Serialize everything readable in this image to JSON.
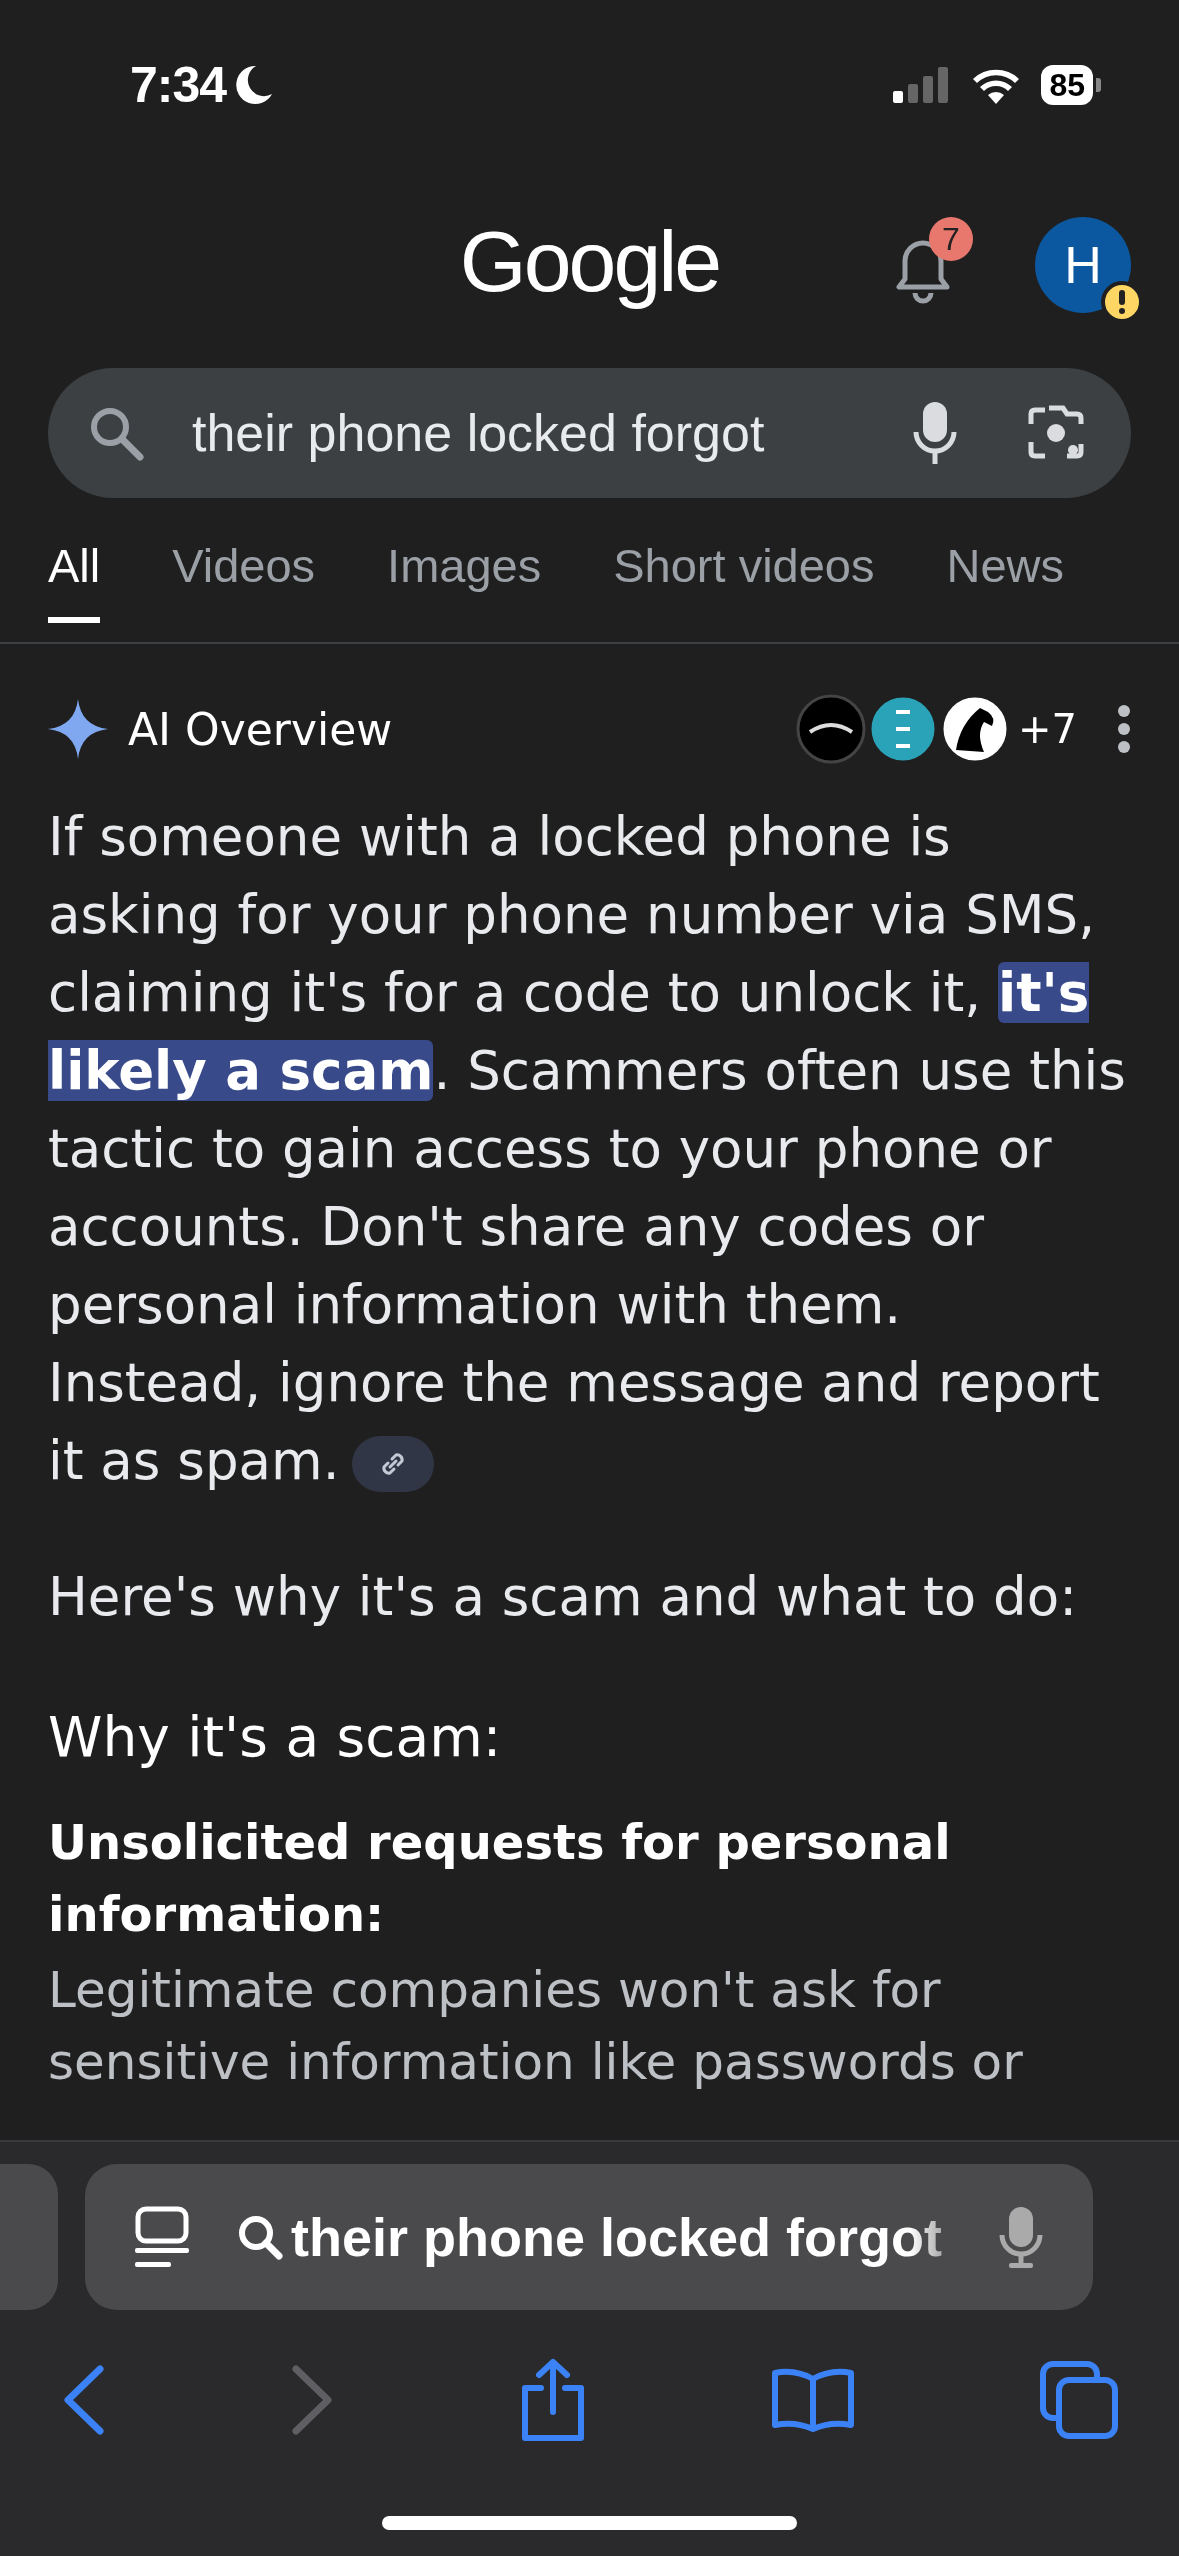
{
  "status_bar": {
    "time": "7:34",
    "battery": "85"
  },
  "header": {
    "logo": "Google",
    "notification_count": "7",
    "avatar": {
      "initial": "H",
      "warning": true
    }
  },
  "search": {
    "value": "their phone locked forgot"
  },
  "tabs": [
    {
      "label": "All",
      "selected": true
    },
    {
      "label": "Videos",
      "selected": false
    },
    {
      "label": "Images",
      "selected": false
    },
    {
      "label": "Short videos",
      "selected": false
    },
    {
      "label": "News",
      "selected": false
    }
  ],
  "ai_overview": {
    "title": "AI Overview",
    "sources_more": "+7",
    "summary": "If someone with a locked phone is asking for your phone number via SMS, claiming it's for a code to unlock it, **it's likely a scam**. Scammers often use this tactic to gain access to your phone or accounts. Don't share any codes or personal information with them. Instead, ignore the message and report it as spam.",
    "intro": "Here's why it's a scam and what to do:",
    "section_title": "Why it's a scam:",
    "points": [
      {
        "title": "Unsolicited requests for personal information:",
        "text": "Legitimate companies won't ask for sensitive information like passwords or"
      }
    ]
  },
  "browser": {
    "address": "their phone locked forgot",
    "nav": [
      {
        "kind": "back",
        "disabled": false
      },
      {
        "kind": "forward",
        "disabled": true
      },
      {
        "kind": "share",
        "disabled": false
      },
      {
        "kind": "bookmarks",
        "disabled": false
      },
      {
        "kind": "tabs",
        "disabled": false
      }
    ]
  }
}
